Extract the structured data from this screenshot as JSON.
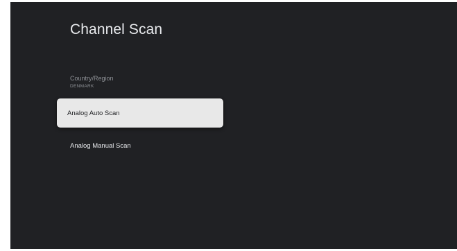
{
  "screen": {
    "title": "Channel Scan",
    "background_color": "#202124"
  },
  "menu": {
    "country_region": {
      "label": "Country/Region",
      "value": "DENMARK"
    },
    "items": [
      {
        "label": "Analog Auto Scan",
        "focused": true
      },
      {
        "label": "Analog Manual Scan",
        "focused": false
      }
    ]
  }
}
